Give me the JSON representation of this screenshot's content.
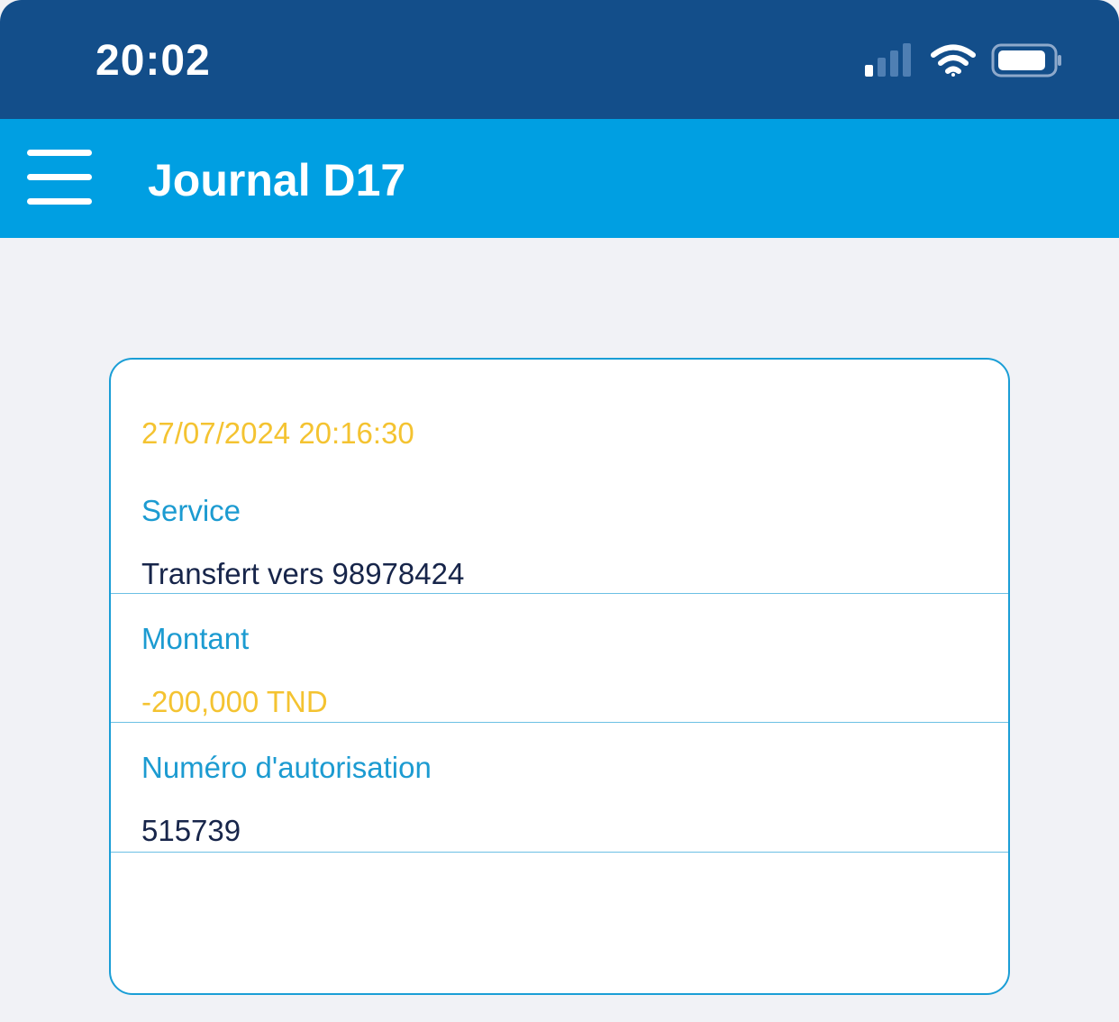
{
  "status_bar": {
    "time": "20:02",
    "icons": [
      "cellular-signal-icon",
      "wifi-icon",
      "battery-icon"
    ]
  },
  "app_bar": {
    "title": "Journal D17",
    "menu_icon": "hamburger-menu-icon"
  },
  "transaction": {
    "datetime": "27/07/2024 20:16:30",
    "fields": [
      {
        "label": "Service",
        "value": "Transfert vers 98978424"
      },
      {
        "label": "Montant",
        "value": "-200,000 TND"
      },
      {
        "label": "Numéro d'autorisation",
        "value": "515739"
      }
    ]
  },
  "colors": {
    "status_bar": "#134e8a",
    "app_bar": "#009fe2",
    "background": "#f1f2f6",
    "card_border": "#1a9ed6",
    "label": "#1c9bd1",
    "value": "#17254a",
    "accent_yellow": "#f4c331"
  }
}
